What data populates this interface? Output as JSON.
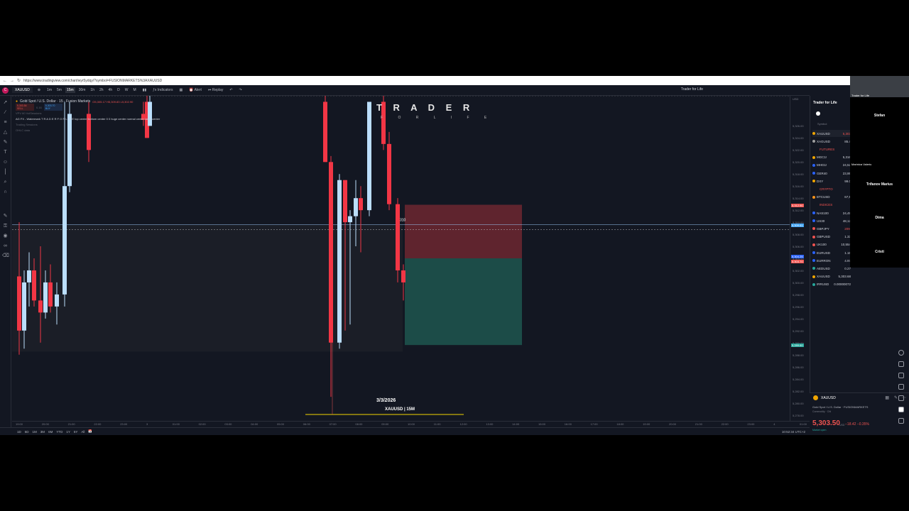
{
  "browser": {
    "url": "https://www.tradingview.com/chart/wyr5ydqy/?symbol=FUSIONMARKETS%3AXAUUSD"
  },
  "toolbar": {
    "logo": "C",
    "symbol": "XAUUSD",
    "intervals": [
      "1m",
      "5m",
      "15m",
      "30m",
      "1h",
      "2h",
      "4h",
      "D",
      "W",
      "M"
    ],
    "active_interval": "15m",
    "indicators_label": "Indicators",
    "alert_label": "Alert",
    "replay_label": "Replay",
    "account_label": "Trader for Life"
  },
  "legend": {
    "title": "Gold Spot / U.S. Dollar · 15 · Fusion Markets",
    "ohlc": "O5,305.17 H5,309.83 L5,302.90",
    "sell_price": "5,303.54",
    "sell_label": "SELL",
    "spread": "0.16",
    "buy_price": "5,303.70",
    "buy_label": "BUY",
    "indicator1": "VPV 60 VolSessions",
    "indicator2": "AG FX - Watermark T R A D E R F O R L I F E top center bottom center 0 0 huge center normal center large center",
    "indicator3": "Trading Sessions",
    "indicator4": "OHLC data"
  },
  "watermark": {
    "line1": "T R A D E R",
    "line2": "F O R   L I F E"
  },
  "chart_overlay": {
    "top_marker": "5330",
    "position_label": "310",
    "date": "3/3/2026",
    "symbol_tf": "XAUUSD | 15M"
  },
  "price_axis": {
    "currency": "USD",
    "labels": [
      "5,326.00",
      "5,324.00",
      "5,322.00",
      "5,320.00",
      "5,318.00",
      "5,316.00",
      "5,314.00",
      "5,312.00",
      "5,310.00",
      "5,308.00",
      "5,306.00",
      "5,304.00",
      "5,302.00",
      "5,300.00",
      "5,298.00",
      "5,296.00",
      "5,294.00",
      "5,292.00",
      "5,290.00",
      "5,288.00",
      "5,286.00",
      "5,284.00",
      "5,282.00",
      "5,280.00",
      "5,278.00"
    ],
    "tag_stop": "5,312.90",
    "tag_current": "5,309.61",
    "tag_sell": "5,304.25",
    "tag_buy": "5,303.70",
    "tag_target": "5,289.60"
  },
  "time_axis": {
    "labels": [
      "19:00",
      "20:00",
      "21:00",
      "22:00",
      "23:00",
      "3",
      "01:00",
      "02:00",
      "03:00",
      "04:00",
      "05:00",
      "06:00",
      "07:00",
      "08:00",
      "09:00",
      "10:00",
      "11:00",
      "12:00",
      "13:00",
      "14:00",
      "15:00",
      "16:00",
      "17:00",
      "18:00",
      "19:00",
      "20:00",
      "21:00",
      "22:00",
      "23:00",
      "4",
      "01:00",
      "02:00"
    ]
  },
  "bottom_bar": {
    "ranges": [
      "1D",
      "5D",
      "1M",
      "3M",
      "6M",
      "YTD",
      "1Y",
      "5Y",
      "All"
    ],
    "clock": "10:52:34 UTC+2"
  },
  "watchlist": {
    "title": "Trader for Life",
    "column": "Symbol",
    "items": [
      {
        "type": "row",
        "symbol": "XAUUSD",
        "price": "5,303",
        "color": "#f0a500",
        "neg": true
      },
      {
        "type": "row",
        "symbol": "XAGUSD",
        "price": "85.4",
        "color": "#9e9e9e",
        "neg": false
      },
      {
        "type": "section",
        "label": "FUTURES"
      },
      {
        "type": "row",
        "symbol": "MGC1!",
        "price": "5,316",
        "color": "#f0a500",
        "neg": false
      },
      {
        "type": "row",
        "symbol": "MHG1!",
        "price": "24,52",
        "color": "#2962ff",
        "neg": false
      },
      {
        "type": "row",
        "symbol": "GER40",
        "price": "23,95",
        "color": "#2962ff",
        "neg": false
      },
      {
        "type": "row",
        "symbol": "DXY",
        "price": "99.0",
        "color": "#f0a500",
        "neg": false
      },
      {
        "type": "section",
        "label": "CRYPTO"
      },
      {
        "type": "row",
        "symbol": "BTCUSD",
        "price": "67,5",
        "color": "#f7931a",
        "neg": false
      },
      {
        "type": "section",
        "label": "INDICES"
      },
      {
        "type": "row",
        "symbol": "NAS100",
        "price": "24,49",
        "color": "#2962ff",
        "neg": false
      },
      {
        "type": "row",
        "symbol": "US30",
        "price": "48,12",
        "color": "#2962ff",
        "neg": false
      },
      {
        "type": "row",
        "symbol": "GBPJPY",
        "price": "209.",
        "color": "#ef5350",
        "neg": true
      },
      {
        "type": "row",
        "symbol": "GBPUSD",
        "price": "1.33",
        "color": "#ef5350",
        "neg": false
      },
      {
        "type": "row",
        "symbol": "UK100",
        "price": "10,554",
        "color": "#ef5350",
        "neg": false
      },
      {
        "type": "row",
        "symbol": "EURUSD",
        "price": "1.16",
        "color": "#2962ff",
        "neg": false
      },
      {
        "type": "row",
        "symbol": "EURRON",
        "price": "4.97",
        "color": "#2962ff",
        "neg": false
      },
      {
        "type": "row",
        "symbol": "AEDUSD",
        "price": "0.27",
        "color": "#26a69a",
        "neg": false
      },
      {
        "type": "row",
        "symbol": "XAUUSD",
        "price": "5,303.68",
        "color": "#f0a500",
        "neg": false
      },
      {
        "type": "row",
        "symbol": "IRRUSD",
        "price": "0.00000072",
        "color": "#26a69a",
        "neg": false
      }
    ]
  },
  "detail": {
    "symbol": "XAUUSD",
    "description": "Gold Spot / U.S. Dollar · FUSIONMARKETS",
    "category": "Commodity · Cfd",
    "price": "5,303.50",
    "currency": "USD",
    "change": "−18.42  −0.35%",
    "market": "Market open"
  },
  "participants": {
    "self": "Trader for Life",
    "names": [
      "Stefan",
      "Marinica Valeriu",
      "Trifanov Marius",
      "Dima",
      "Cristi"
    ]
  },
  "chart_data": {
    "type": "candlestick",
    "xlabel": "",
    "ylabel": "",
    "ylim": [
      5277,
      5331
    ],
    "candles": [
      {
        "t": "19:00",
        "o": 5301,
        "h": 5310,
        "l": 5288,
        "c": 5292
      },
      {
        "t": "19:15",
        "o": 5292,
        "h": 5302,
        "l": 5289,
        "c": 5300
      },
      {
        "t": "19:30",
        "o": 5300,
        "h": 5305,
        "l": 5296,
        "c": 5302
      },
      {
        "t": "19:45",
        "o": 5302,
        "h": 5304,
        "l": 5296,
        "c": 5297
      },
      {
        "t": "20:00",
        "o": 5297,
        "h": 5306,
        "l": 5290,
        "c": 5295
      },
      {
        "t": "20:15",
        "o": 5295,
        "h": 5302,
        "l": 5294,
        "c": 5300
      },
      {
        "t": "20:30",
        "o": 5300,
        "h": 5303,
        "l": 5295,
        "c": 5296
      },
      {
        "t": "20:45",
        "o": 5296,
        "h": 5300,
        "l": 5293,
        "c": 5298
      },
      {
        "t": "21:00",
        "o": 5298,
        "h": 5330,
        "l": 5296,
        "c": 5316
      },
      {
        "t": "21:15",
        "o": 5316,
        "h": 5330,
        "l": 5315,
        "c": 5328
      },
      {
        "t": "21:30",
        "o": 5328,
        "h": 5330,
        "l": 5320,
        "c": 5322
      },
      {
        "t": "22:00",
        "o": 5328,
        "h": 5330,
        "l": 5326,
        "c": 5327
      },
      {
        "t": "22:45",
        "o": 5330,
        "h": 5331,
        "l": 5324,
        "c": 5324
      },
      {
        "t": "23:00",
        "o": 5326,
        "h": 5331,
        "l": 5326,
        "c": 5330
      },
      {
        "t": "07:45",
        "o": 5330,
        "h": 5331,
        "l": 5320,
        "c": 5320
      },
      {
        "t": "08:00",
        "o": 5320,
        "h": 5321,
        "l": 5281,
        "c": 5290
      },
      {
        "t": "08:15",
        "o": 5290,
        "h": 5318,
        "l": 5289,
        "c": 5317
      },
      {
        "t": "08:30",
        "o": 5317,
        "h": 5317,
        "l": 5292,
        "c": 5310
      },
      {
        "t": "08:45",
        "o": 5310,
        "h": 5312,
        "l": 5293,
        "c": 5311
      },
      {
        "t": "09:00",
        "o": 5311,
        "h": 5317,
        "l": 5306,
        "c": 5314
      },
      {
        "t": "09:15",
        "o": 5314,
        "h": 5316,
        "l": 5305,
        "c": 5312
      },
      {
        "t": "09:30",
        "o": 5312,
        "h": 5330,
        "l": 5311,
        "c": 5330
      },
      {
        "t": "09:45",
        "o": 5330,
        "h": 5331,
        "l": 5322,
        "c": 5323
      },
      {
        "t": "10:00",
        "o": 5323,
        "h": 5325,
        "l": 5312,
        "c": 5313
      },
      {
        "t": "10:15",
        "o": 5313,
        "h": 5314,
        "l": 5300,
        "c": 5302
      },
      {
        "t": "10:30",
        "o": 5302,
        "h": 5303,
        "l": 5297,
        "c": 5300
      }
    ],
    "position": {
      "side": "short",
      "entry": 5304,
      "stop": 5312.9,
      "target": 5289.6
    },
    "current_price": 5309.6
  }
}
